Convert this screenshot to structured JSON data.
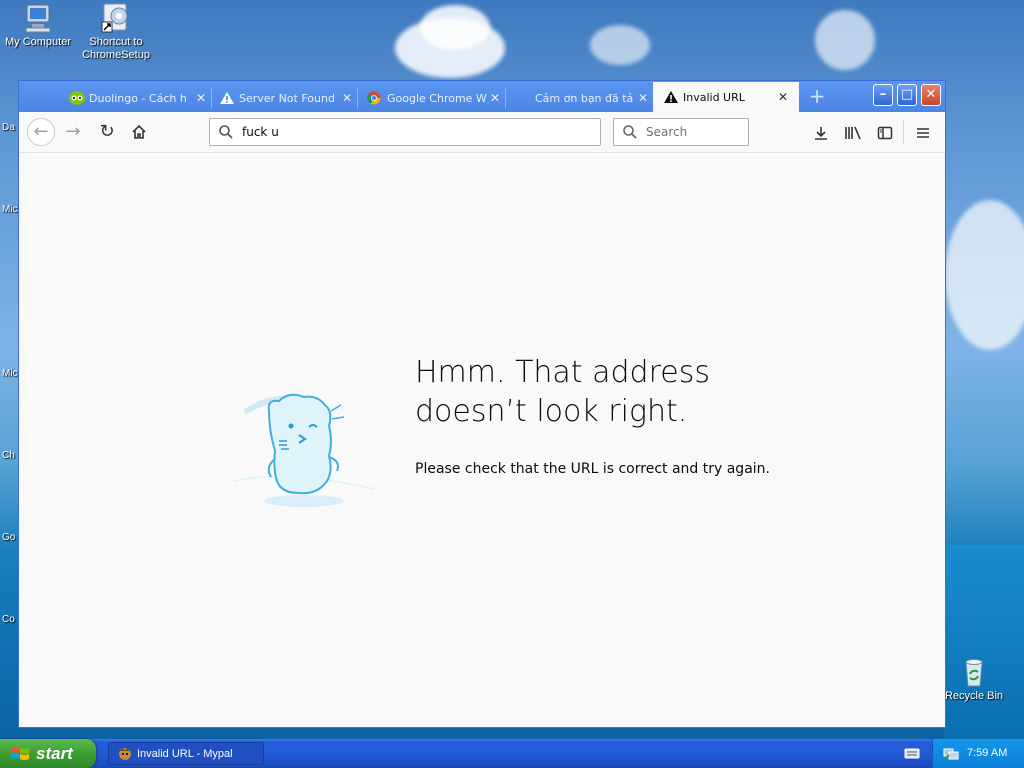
{
  "desktop": {
    "icons": [
      {
        "label_lines": [
          "My Computer"
        ],
        "icon": "computer-icon"
      },
      {
        "label_lines": [
          "Shortcut to",
          "ChromeSetup"
        ],
        "icon": "setup-shortcut-icon"
      },
      {
        "label_lines": [
          "Recycle Bin"
        ],
        "icon": "recycle-bin-icon"
      }
    ],
    "edge_fragments": [
      "Da",
      "Mic",
      "Mic",
      "Ch",
      "Go",
      "Co"
    ]
  },
  "browser": {
    "tabs": [
      {
        "title": "Duolingo - Cách h",
        "icon": "duolingo-owl-icon"
      },
      {
        "title": "Server Not Found",
        "icon": "warning-icon"
      },
      {
        "title": "Google Chrome W",
        "icon": "chrome-icon"
      },
      {
        "title": "Cảm ơn bạn đã tả",
        "icon": ""
      },
      {
        "title": "Invalid URL",
        "icon": "warning-icon",
        "active": true
      }
    ],
    "new_tab": "+",
    "url_value": "fuck u",
    "search_placeholder": "Search",
    "window_buttons": {
      "minimize": "–",
      "maximize": "□",
      "close": "✕"
    }
  },
  "error_page": {
    "title_line1": "Hmm. That address",
    "title_line2": "doesn’t look right.",
    "description": "Please check that the URL is correct and try again."
  },
  "taskbar": {
    "start_label": "start",
    "task_label": "Invalid URL - Mypal",
    "clock": "7:59 AM"
  },
  "colors": {
    "tab_bar": "#4f8ae8",
    "page_bg": "#f9f9fa",
    "taskbar": "#225ad6",
    "start_green": "#3c9d33"
  }
}
